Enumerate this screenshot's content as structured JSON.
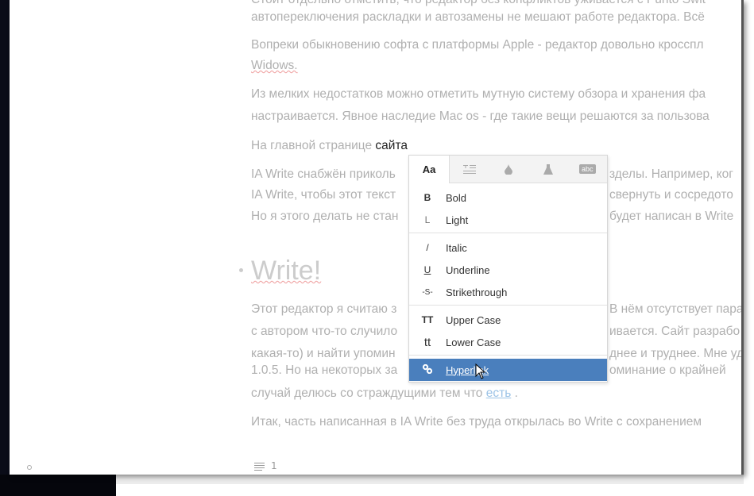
{
  "document": {
    "lines": [
      "Стоит отдельно отметить, что редактор без конфликтов уживается с Punto Swit",
      "автопереключения раскладки и автозамены не мешают работе редактора. Всё",
      "Вопреки обыкновению софта с платформы Apple - редактор довольно кросспл",
      "Widows.",
      "Из мелких недостатков можно отметить мутную систему обзора и хранения фа",
      "настраивается. Явное наследие Mac os - где такие вещи решаются за пользова"
    ],
    "selected_line_prefix": "На главной странице ",
    "selected_word": "сайта",
    "partial_lines": [
      {
        "left": "IA Write снабжён приколь",
        "right": "зделы. Например, ког"
      },
      {
        "left": "IA Write, чтобы этот текст",
        "right": "свернуть и сосредото"
      },
      {
        "left": "Но я этого делать не стан",
        "right": "будет написан в Write"
      }
    ],
    "heading": "Write!",
    "partial_lines2": [
      {
        "left": "Этот редактор я считаю з",
        "right": "В нём отсутствует пара"
      },
      {
        "left": "с автором что-то случило",
        "right": "ивается. Сайт разрабо"
      },
      {
        "left": "какая-то) и найти упомин",
        "right": "днее и труднее. Мне уд"
      },
      {
        "left": "1.0.5. Но на некоторых за",
        "right": "оминание о крайней"
      }
    ],
    "link_line_prefix": "случай делюсь со страждущими тем что ",
    "link_text": "есть",
    "link_line_suffix": " .",
    "last_line": "Итак, часть написанная в IA Write без труда открылась во Write с сохранением"
  },
  "format_menu": {
    "tabs": [
      {
        "label": "Aa",
        "icon": "font-icon",
        "active": true
      },
      {
        "label": "",
        "icon": "paragraph-icon"
      },
      {
        "label": "",
        "icon": "color-drop-icon"
      },
      {
        "label": "",
        "icon": "flask-icon"
      },
      {
        "label": "abc",
        "icon": "spellcheck-icon"
      }
    ],
    "items": [
      {
        "icon": "B",
        "label": "Bold"
      },
      {
        "icon": "L",
        "label": "Light"
      },
      {
        "icon": "/",
        "label": "Italic"
      },
      {
        "icon": "U",
        "label": "Underline"
      },
      {
        "icon": "-S-",
        "label": "Strikethrough"
      },
      {
        "icon": "TT",
        "label": "Upper Case"
      },
      {
        "icon": "tt",
        "label": "Lower Case"
      },
      {
        "icon": "link",
        "label": "Hyperlink",
        "highlighted": true
      }
    ]
  },
  "status": {
    "count": "1"
  },
  "colors": {
    "highlight": "#4a7fbd",
    "text": "#b0b0b0",
    "link": "#9cc3e6"
  }
}
